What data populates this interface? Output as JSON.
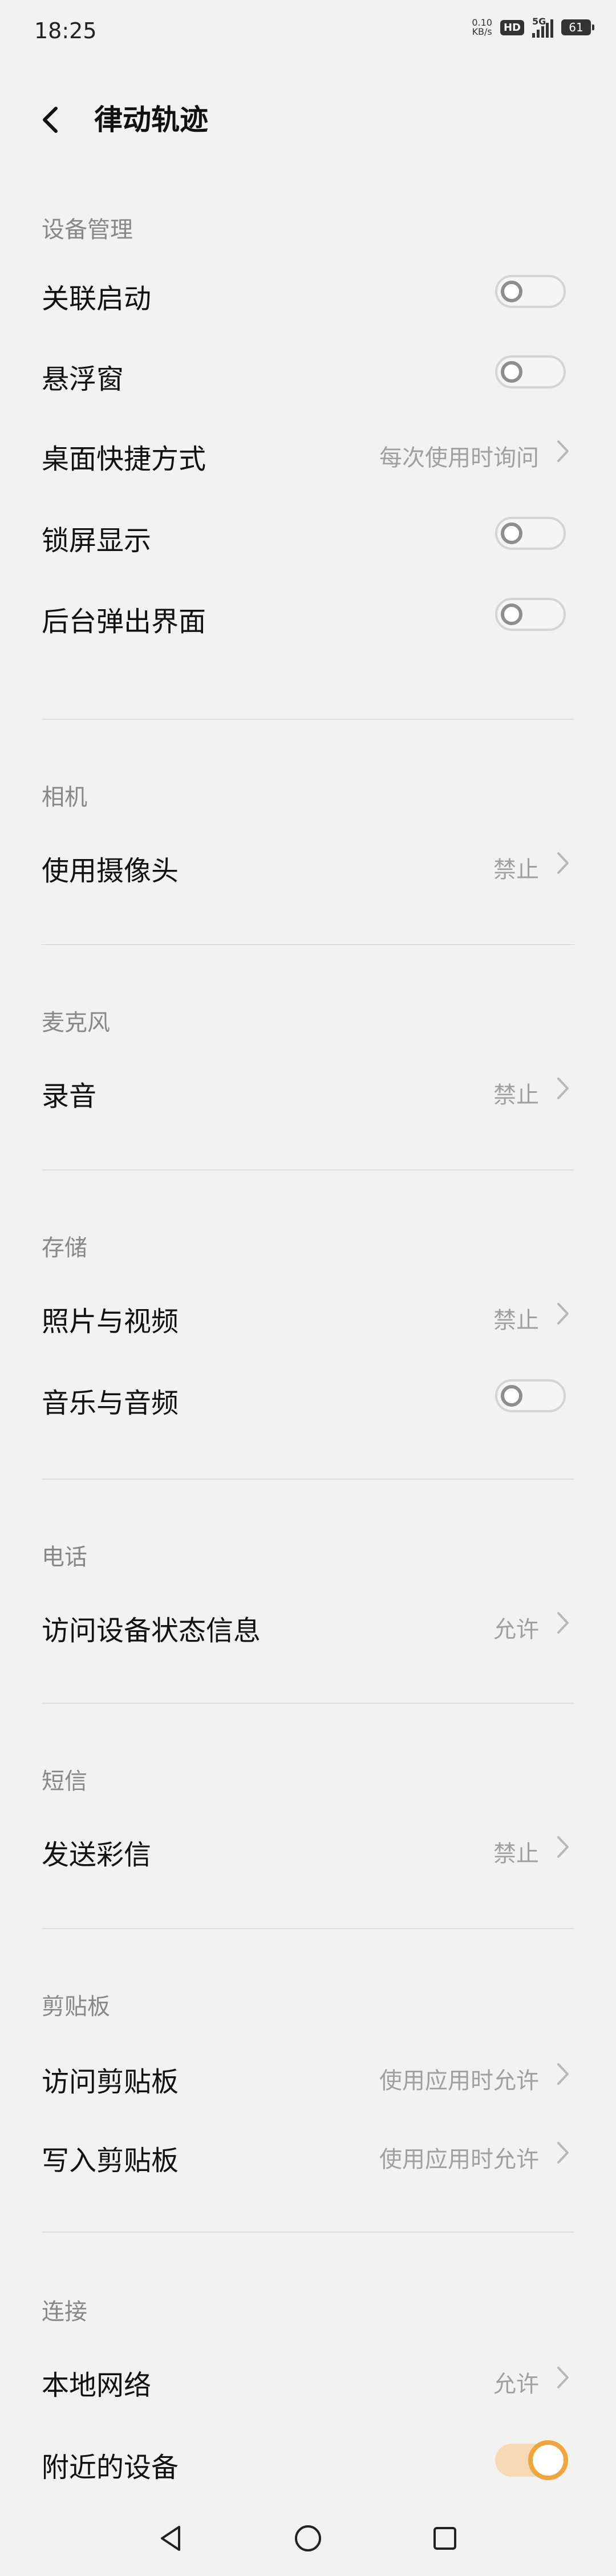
{
  "status_bar": {
    "time": "18:25",
    "speed_value": "0.10",
    "speed_unit": "KB/s",
    "hd": "HD",
    "network": "5G",
    "battery": "61"
  },
  "header": {
    "title": "律动轨迹"
  },
  "sections": {
    "device": {
      "label": "设备管理",
      "assoc_launch": "关联启动",
      "float_window": "悬浮窗",
      "shortcut": "桌面快捷方式",
      "shortcut_value": "每次使用时询问",
      "lock_screen": "锁屏显示",
      "background_popup": "后台弹出界面"
    },
    "camera": {
      "label": "相机",
      "use_camera": "使用摄像头",
      "use_camera_value": "禁止"
    },
    "microphone": {
      "label": "麦克风",
      "record": "录音",
      "record_value": "禁止"
    },
    "storage": {
      "label": "存储",
      "photos": "照片与视频",
      "photos_value": "禁止",
      "audio": "音乐与音频"
    },
    "phone": {
      "label": "电话",
      "device_state": "访问设备状态信息",
      "device_state_value": "允许"
    },
    "sms": {
      "label": "短信",
      "send_mms": "发送彩信",
      "send_mms_value": "禁止"
    },
    "clipboard": {
      "label": "剪贴板",
      "read": "访问剪贴板",
      "read_value": "使用应用时允许",
      "write": "写入剪贴板",
      "write_value": "使用应用时允许"
    },
    "connection": {
      "label": "连接",
      "local_network": "本地网络",
      "local_network_value": "允许",
      "nearby_devices": "附近的设备"
    }
  },
  "toggles": {
    "assoc_launch": false,
    "float_window": false,
    "lock_screen": false,
    "background_popup": false,
    "audio": false,
    "nearby_devices": true
  },
  "colors": {
    "accent": "#f0a640",
    "background": "#f2f2f2"
  },
  "icons": [
    "back-arrow-icon",
    "chevron-right-icon",
    "nav-back-icon",
    "nav-home-icon",
    "nav-recents-icon"
  ]
}
